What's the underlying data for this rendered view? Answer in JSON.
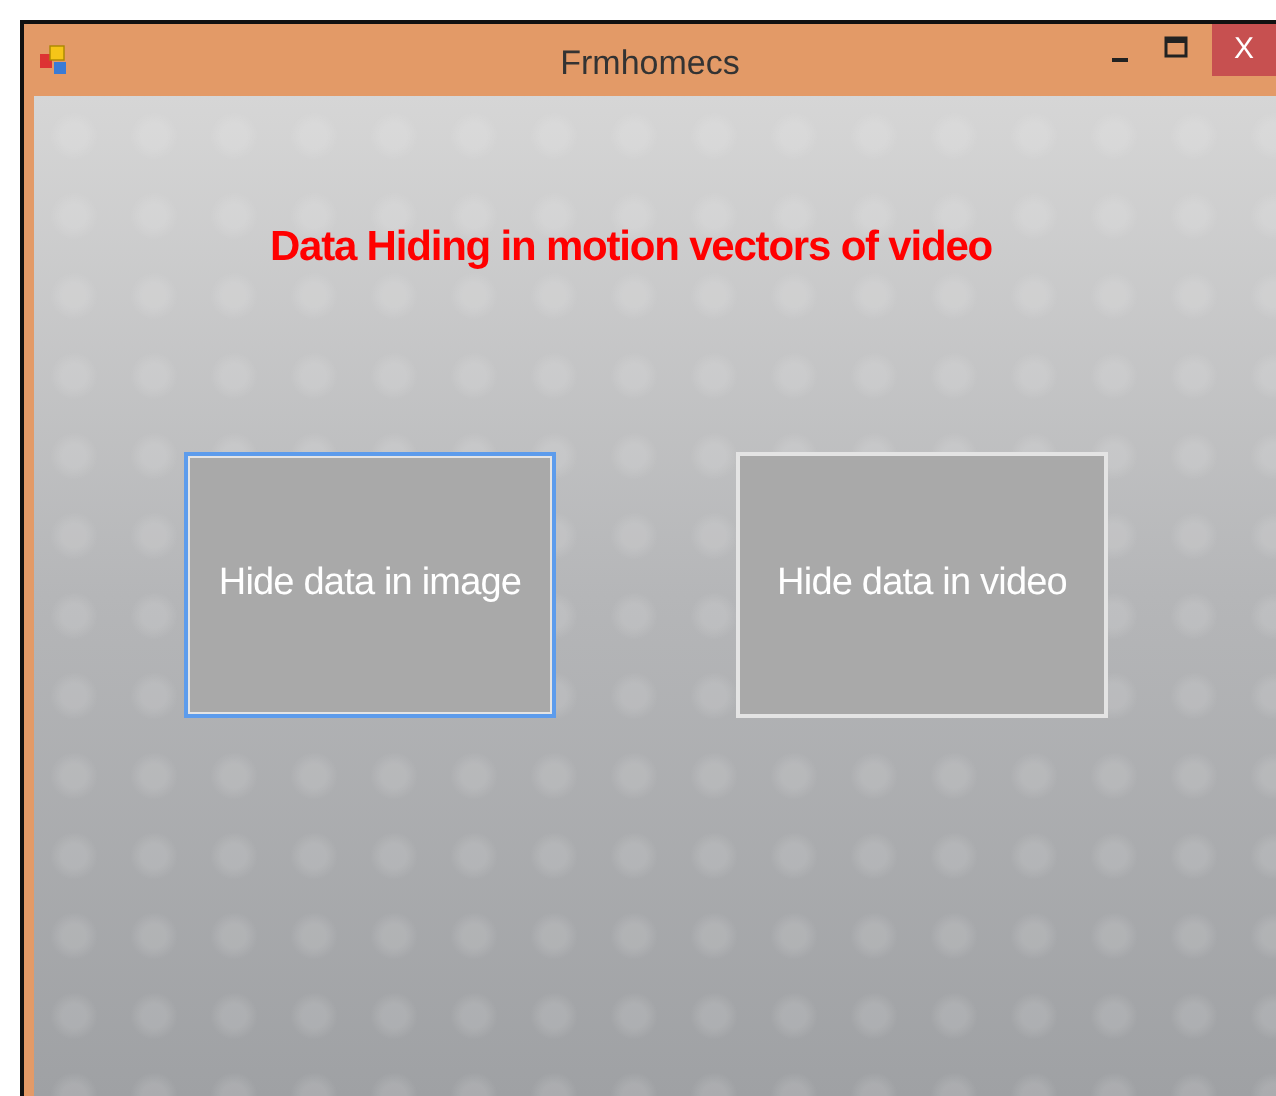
{
  "window": {
    "title": "Frmhomecs",
    "controls": [
      "X"
    ]
  },
  "heading": "Data Hiding in motion vectors of video",
  "buttons": [
    {
      "label": "Hide data in image",
      "focused": true
    },
    {
      "label": "Hide data in video",
      "focused": false
    }
  ]
}
